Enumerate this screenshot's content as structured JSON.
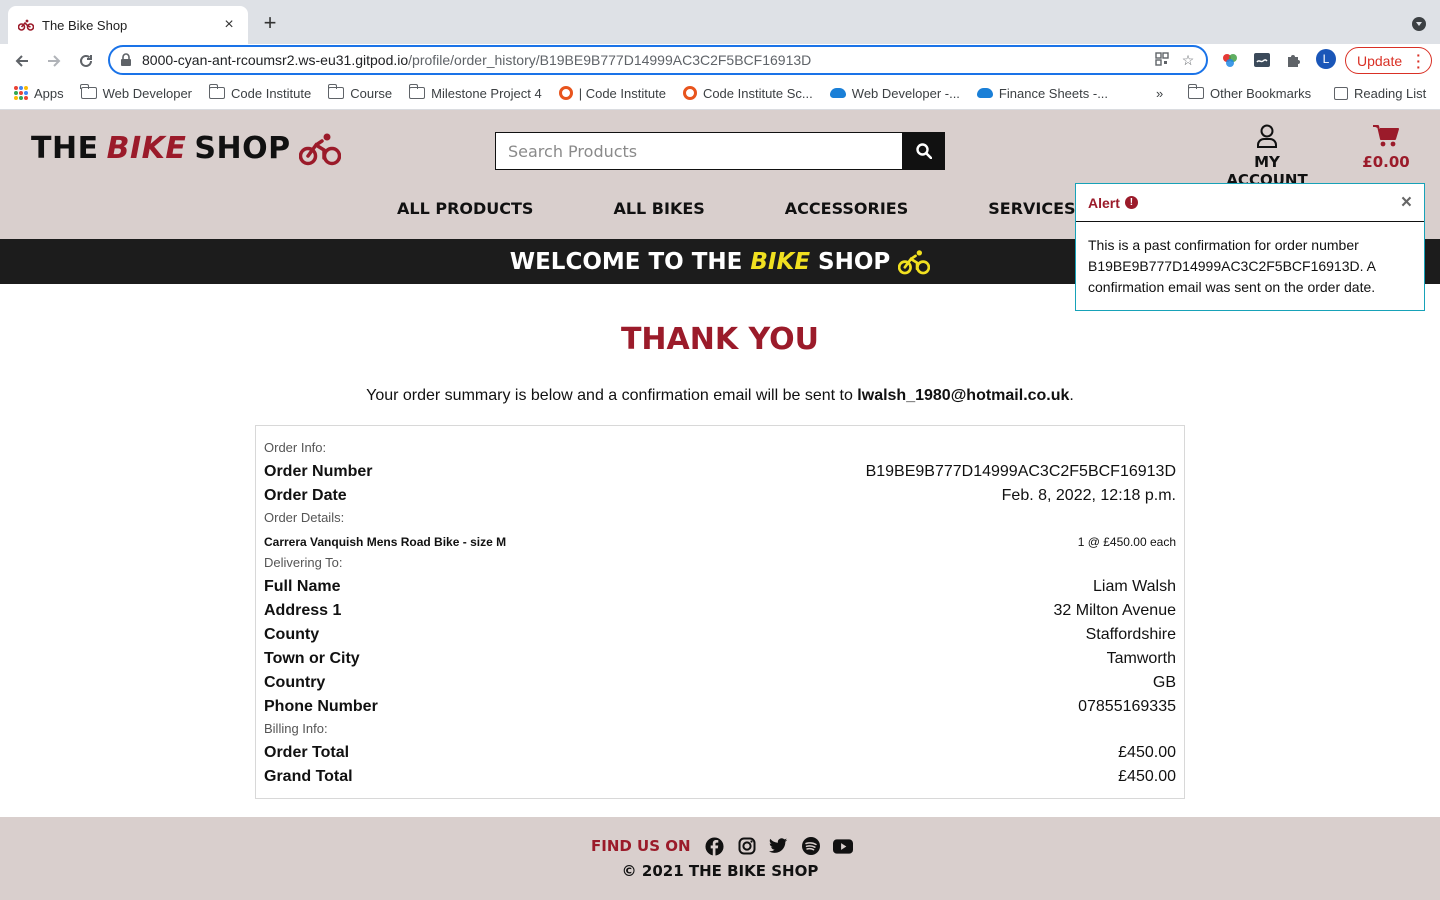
{
  "browser": {
    "tab_title": "The Bike Shop",
    "url_host": "8000-cyan-ant-rcoumsr2.ws-eu31.gitpod.io",
    "url_path": "/profile/order_history/B19BE9B777D14999AC3C2F5BCF16913D",
    "profile_initial": "L",
    "update_label": "Update",
    "bookmarks": [
      "Apps",
      "Web Developer",
      "Code Institute",
      "Course",
      "Milestone Project 4",
      "| Code Institute",
      "Code Institute Sc...",
      "Web Developer -...",
      "Finance Sheets -..."
    ],
    "overflow": "»",
    "other_bookmarks": "Other Bookmarks",
    "reading_list": "Reading List"
  },
  "header": {
    "logo_the": "THE",
    "logo_bike": "BIKE",
    "logo_shop": "SHOP",
    "search_placeholder": "Search Products",
    "account_label": "MY ACCOUNT",
    "cart_total": "£0.00"
  },
  "nav": [
    "ALL PRODUCTS",
    "ALL BIKES",
    "ACCESSORIES",
    "SERVICES"
  ],
  "banner": {
    "pre": "WELCOME TO THE",
    "bike": "BIKE",
    "post": "SHOP"
  },
  "alert": {
    "title": "Alert",
    "badge": "!",
    "close": "×",
    "message": "This is a past confirmation for order number B19BE9B777D14999AC3C2F5BCF16913D. A confirmation email was sent on the order date."
  },
  "main": {
    "heading": "THANK YOU",
    "summary_pre": "Your order summary is below and a confirmation email will be sent to ",
    "email": "lwalsh_1980@hotmail.co.uk",
    "summary_post": "."
  },
  "order": {
    "info_label": "Order Info:",
    "order_number_label": "Order Number",
    "order_number": "B19BE9B777D14999AC3C2F5BCF16913D",
    "order_date_label": "Order Date",
    "order_date": "Feb. 8, 2022, 12:18 p.m.",
    "details_label": "Order Details:",
    "item_name": "Carrera Vanquish Mens Road Bike - size M",
    "item_qty": "1 @ £450.00 each",
    "delivering_label": "Delivering To:",
    "full_name_label": "Full Name",
    "full_name": "Liam Walsh",
    "address1_label": "Address 1",
    "address1": "32 Milton Avenue",
    "county_label": "County",
    "county": "Staffordshire",
    "town_label": "Town or City",
    "town": "Tamworth",
    "country_label": "Country",
    "country": "GB",
    "phone_label": "Phone Number",
    "phone": "07855169335",
    "billing_label": "Billing Info:",
    "order_total_label": "Order Total",
    "order_total": "£450.00",
    "grand_total_label": "Grand Total",
    "grand_total": "£450.00"
  },
  "footer": {
    "find_us": "FIND US ON",
    "social_icons": [
      "facebook-icon",
      "instagram-icon",
      "twitter-icon",
      "spotify-icon",
      "youtube-icon"
    ],
    "copyright": "© 2021 THE BIKE SHOP"
  },
  "colors": {
    "brand_red": "#9b1b2a",
    "banner_yellow": "#f1e020",
    "header_bg": "#d9cfcd",
    "alert_border": "#17a2b8"
  }
}
